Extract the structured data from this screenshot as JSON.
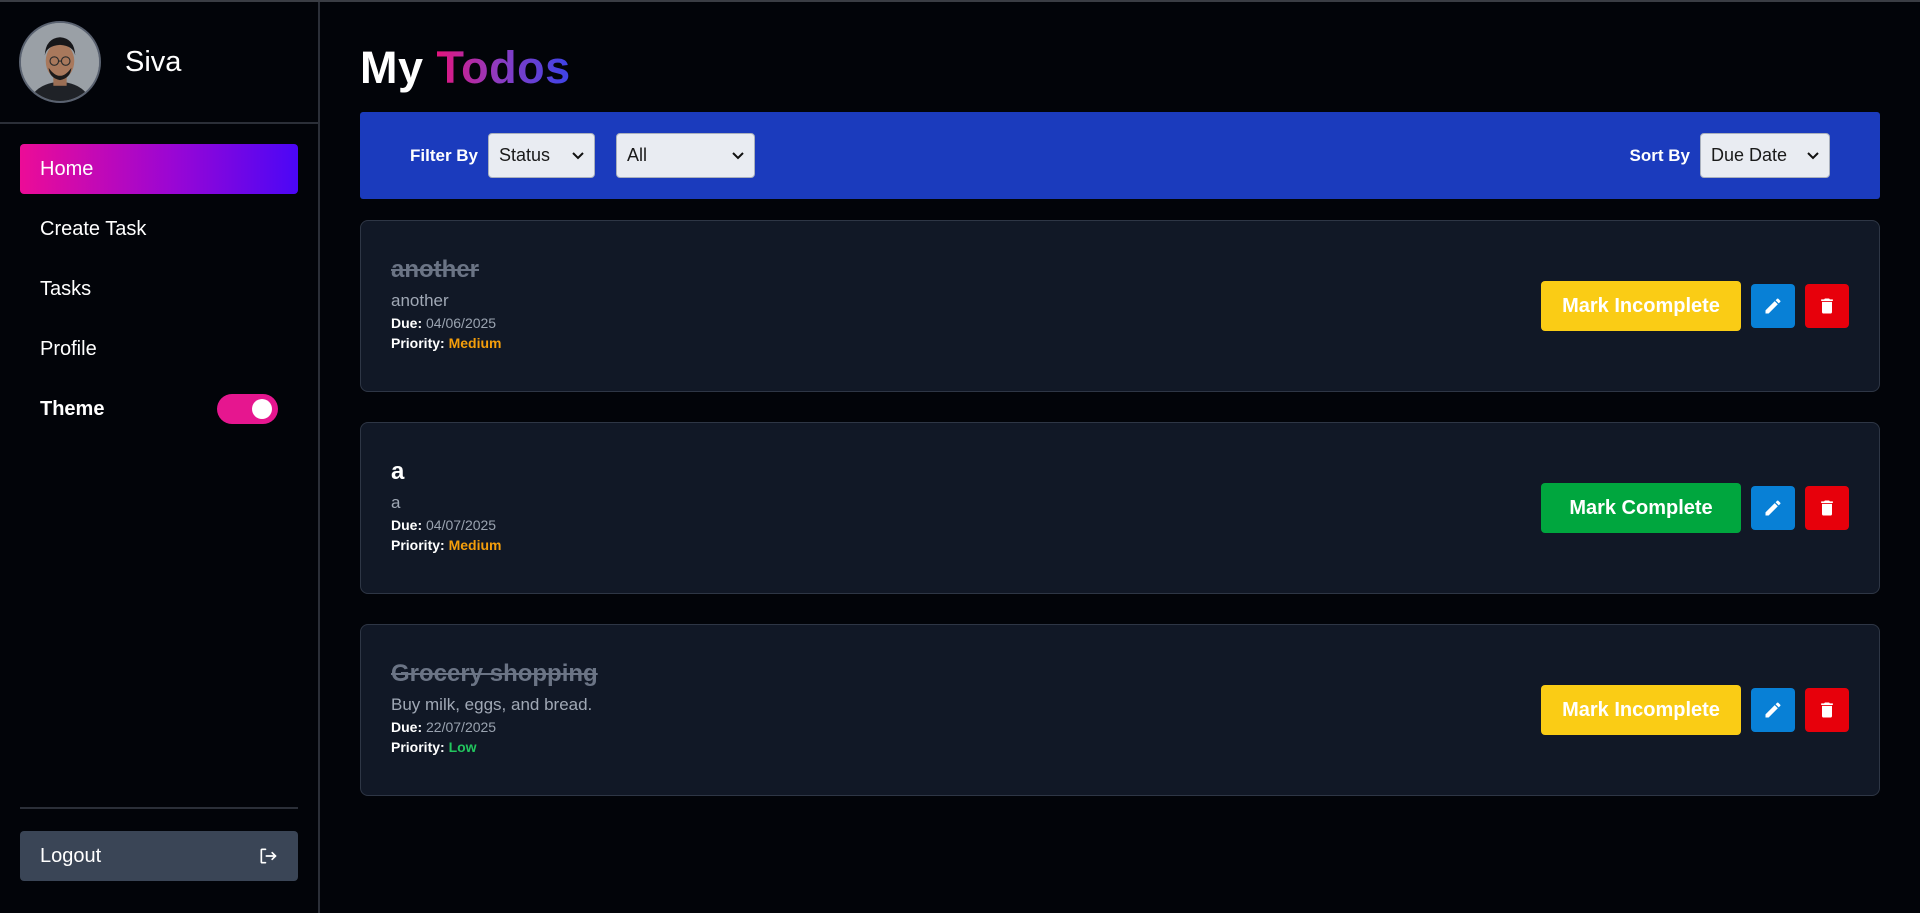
{
  "sidebar": {
    "username": "Siva",
    "nav": [
      {
        "label": "Home",
        "active": true
      },
      {
        "label": "Create Task",
        "active": false
      },
      {
        "label": "Tasks",
        "active": false
      },
      {
        "label": "Profile",
        "active": false
      }
    ],
    "theme_label": "Theme",
    "theme_toggle_on": true,
    "logout_label": "Logout"
  },
  "main": {
    "title_part1": "My",
    "title_part2": "Todos",
    "filter": {
      "filter_label": "Filter By",
      "filter_field_value": "Status",
      "filter_value": "All",
      "sort_label": "Sort By",
      "sort_value": "Due Date"
    },
    "todos": [
      {
        "title": "another",
        "description": "another",
        "due_label": "Due:",
        "due": "04/06/2025",
        "priority_label": "Priority:",
        "priority": "Medium",
        "completed": true,
        "action_label": "Mark Incomplete"
      },
      {
        "title": "a",
        "description": "a",
        "due_label": "Due:",
        "due": "04/07/2025",
        "priority_label": "Priority:",
        "priority": "Medium",
        "completed": false,
        "action_label": "Mark Complete"
      },
      {
        "title": "Grocery shopping",
        "description": "Buy milk, eggs, and bread.",
        "due_label": "Due:",
        "due": "22/07/2025",
        "priority_label": "Priority:",
        "priority": "Low",
        "completed": true,
        "action_label": "Mark Incomplete"
      }
    ]
  },
  "icons": {
    "edit": "pencil-icon",
    "delete": "trash-icon",
    "logout": "logout-icon",
    "select": "chevron-down-icon"
  },
  "colors": {
    "accent_pink": "#ec0c97",
    "accent_violet": "#4b06f6",
    "filter_bar": "#1b3bbd",
    "mark_incomplete": "#facc15",
    "mark_complete": "#00a63e",
    "edit": "#0880d6",
    "delete": "#e7000b",
    "priority_medium": "#f59e0b",
    "priority_low": "#22c55e"
  }
}
